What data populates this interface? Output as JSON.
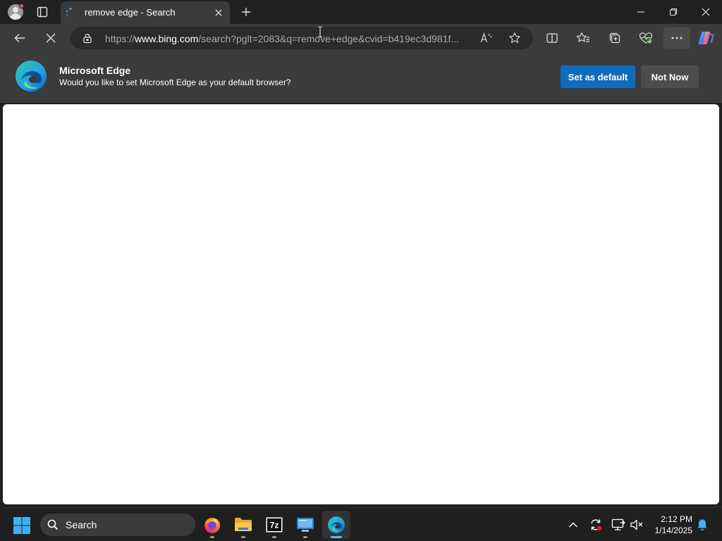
{
  "tab": {
    "title": "remove edge - Search"
  },
  "address": {
    "scheme": "https://",
    "host": "www.bing.com",
    "rest": "/search?pglt=2083&q=remove+edge&cvid=b419ec3d981f..."
  },
  "infobar": {
    "title": "Microsoft Edge",
    "message": "Would you like to set Microsoft Edge as your default browser?",
    "primary_button": "Set as default",
    "secondary_button": "Not Now"
  },
  "taskbar": {
    "search_label": "Search",
    "time": "2:12 PM",
    "date": "1/14/2025"
  },
  "colors": {
    "accent": "#0f6cbd",
    "taskbar_active_indicator": "#4cc2ff"
  }
}
